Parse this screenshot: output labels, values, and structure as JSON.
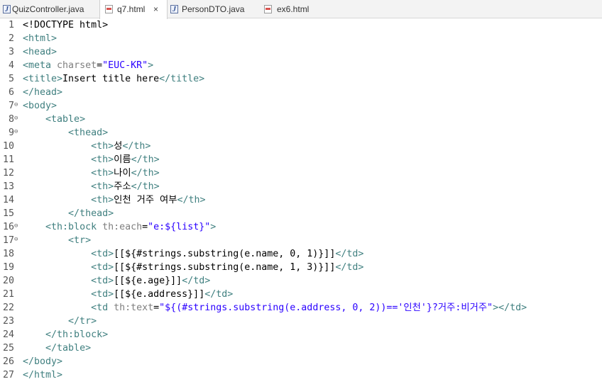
{
  "tabs": [
    {
      "label": "QuizController.java",
      "icon": "java-file-icon"
    },
    {
      "label": "q7.html",
      "icon": "html-file-icon",
      "active": true,
      "close": "×"
    },
    {
      "label": "PersonDTO.java",
      "icon": "java-file-icon"
    },
    {
      "label": "ex6.html",
      "icon": "html-file-icon"
    }
  ],
  "colors": {
    "tag": "#3f7f7f",
    "attr": "#7f7f7f",
    "value": "#2a00ff",
    "text": "#000000"
  },
  "fold_icon": "⊖",
  "lines": [
    {
      "n": "1",
      "fold": false,
      "segs": [
        [
          "k",
          "<!DOCTYPE html>"
        ]
      ]
    },
    {
      "n": "2",
      "fold": false,
      "segs": [
        [
          "t",
          "<html>"
        ]
      ]
    },
    {
      "n": "3",
      "fold": false,
      "segs": [
        [
          "t",
          "<head>"
        ]
      ]
    },
    {
      "n": "4",
      "fold": false,
      "segs": [
        [
          "t",
          "<meta "
        ],
        [
          "a",
          "charset"
        ],
        [
          "k",
          "="
        ],
        [
          "v",
          "\"EUC-KR\""
        ],
        [
          "t",
          ">"
        ]
      ]
    },
    {
      "n": "5",
      "fold": false,
      "segs": [
        [
          "t",
          "<title>"
        ],
        [
          "k",
          "Insert title here"
        ],
        [
          "t",
          "</title>"
        ]
      ]
    },
    {
      "n": "6",
      "fold": false,
      "segs": [
        [
          "t",
          "</head>"
        ]
      ]
    },
    {
      "n": "7",
      "fold": true,
      "segs": [
        [
          "t",
          "<body>"
        ]
      ]
    },
    {
      "n": "8",
      "fold": true,
      "segs": [
        [
          "k",
          "    "
        ],
        [
          "t",
          "<table>"
        ]
      ]
    },
    {
      "n": "9",
      "fold": true,
      "segs": [
        [
          "k",
          "        "
        ],
        [
          "t",
          "<thead>"
        ]
      ]
    },
    {
      "n": "10",
      "fold": false,
      "segs": [
        [
          "k",
          "            "
        ],
        [
          "t",
          "<th>"
        ],
        [
          "k",
          "성"
        ],
        [
          "t",
          "</th>"
        ]
      ]
    },
    {
      "n": "11",
      "fold": false,
      "segs": [
        [
          "k",
          "            "
        ],
        [
          "t",
          "<th>"
        ],
        [
          "k",
          "이름"
        ],
        [
          "t",
          "</th>"
        ]
      ]
    },
    {
      "n": "12",
      "fold": false,
      "segs": [
        [
          "k",
          "            "
        ],
        [
          "t",
          "<th>"
        ],
        [
          "k",
          "나이"
        ],
        [
          "t",
          "</th>"
        ]
      ]
    },
    {
      "n": "13",
      "fold": false,
      "segs": [
        [
          "k",
          "            "
        ],
        [
          "t",
          "<th>"
        ],
        [
          "k",
          "주소"
        ],
        [
          "t",
          "</th>"
        ]
      ]
    },
    {
      "n": "14",
      "fold": false,
      "segs": [
        [
          "k",
          "            "
        ],
        [
          "t",
          "<th>"
        ],
        [
          "k",
          "인천 거주 여부"
        ],
        [
          "t",
          "</th>"
        ]
      ]
    },
    {
      "n": "15",
      "fold": false,
      "segs": [
        [
          "k",
          "        "
        ],
        [
          "t",
          "</thead>"
        ]
      ]
    },
    {
      "n": "16",
      "fold": true,
      "segs": [
        [
          "k",
          "    "
        ],
        [
          "t",
          "<th:block "
        ],
        [
          "a",
          "th:each"
        ],
        [
          "k",
          "="
        ],
        [
          "v",
          "\"e:${list}\""
        ],
        [
          "t",
          ">"
        ]
      ]
    },
    {
      "n": "17",
      "fold": true,
      "segs": [
        [
          "k",
          "        "
        ],
        [
          "t",
          "<tr>"
        ]
      ]
    },
    {
      "n": "18",
      "fold": false,
      "segs": [
        [
          "k",
          "            "
        ],
        [
          "t",
          "<td>"
        ],
        [
          "k",
          "[[${#strings.substring(e.name, 0, 1)}]]"
        ],
        [
          "t",
          "</td>"
        ]
      ]
    },
    {
      "n": "19",
      "fold": false,
      "segs": [
        [
          "k",
          "            "
        ],
        [
          "t",
          "<td>"
        ],
        [
          "k",
          "[[${#strings.substring(e.name, 1, 3)}]]"
        ],
        [
          "t",
          "</td>"
        ]
      ]
    },
    {
      "n": "20",
      "fold": false,
      "segs": [
        [
          "k",
          "            "
        ],
        [
          "t",
          "<td>"
        ],
        [
          "k",
          "[[${e.age}]]"
        ],
        [
          "t",
          "</td>"
        ]
      ]
    },
    {
      "n": "21",
      "fold": false,
      "segs": [
        [
          "k",
          "            "
        ],
        [
          "t",
          "<td>"
        ],
        [
          "k",
          "[[${e.address}]]"
        ],
        [
          "t",
          "</td>"
        ]
      ]
    },
    {
      "n": "22",
      "fold": false,
      "segs": [
        [
          "k",
          "            "
        ],
        [
          "t",
          "<td "
        ],
        [
          "a",
          "th:text"
        ],
        [
          "k",
          "="
        ],
        [
          "v",
          "\"${(#strings.substring(e.address, 0, 2))=='인천'}?거주:비거주\""
        ],
        [
          "t",
          "></td>"
        ]
      ]
    },
    {
      "n": "23",
      "fold": false,
      "segs": [
        [
          "k",
          "        "
        ],
        [
          "t",
          "</tr>"
        ]
      ]
    },
    {
      "n": "24",
      "fold": false,
      "segs": [
        [
          "k",
          "    "
        ],
        [
          "t",
          "</th:block>"
        ]
      ]
    },
    {
      "n": "25",
      "fold": false,
      "segs": [
        [
          "k",
          "    "
        ],
        [
          "t",
          "</table>"
        ]
      ]
    },
    {
      "n": "26",
      "fold": false,
      "segs": [
        [
          "t",
          "</body>"
        ]
      ]
    },
    {
      "n": "27",
      "fold": false,
      "segs": [
        [
          "t",
          "</html>"
        ]
      ]
    }
  ]
}
